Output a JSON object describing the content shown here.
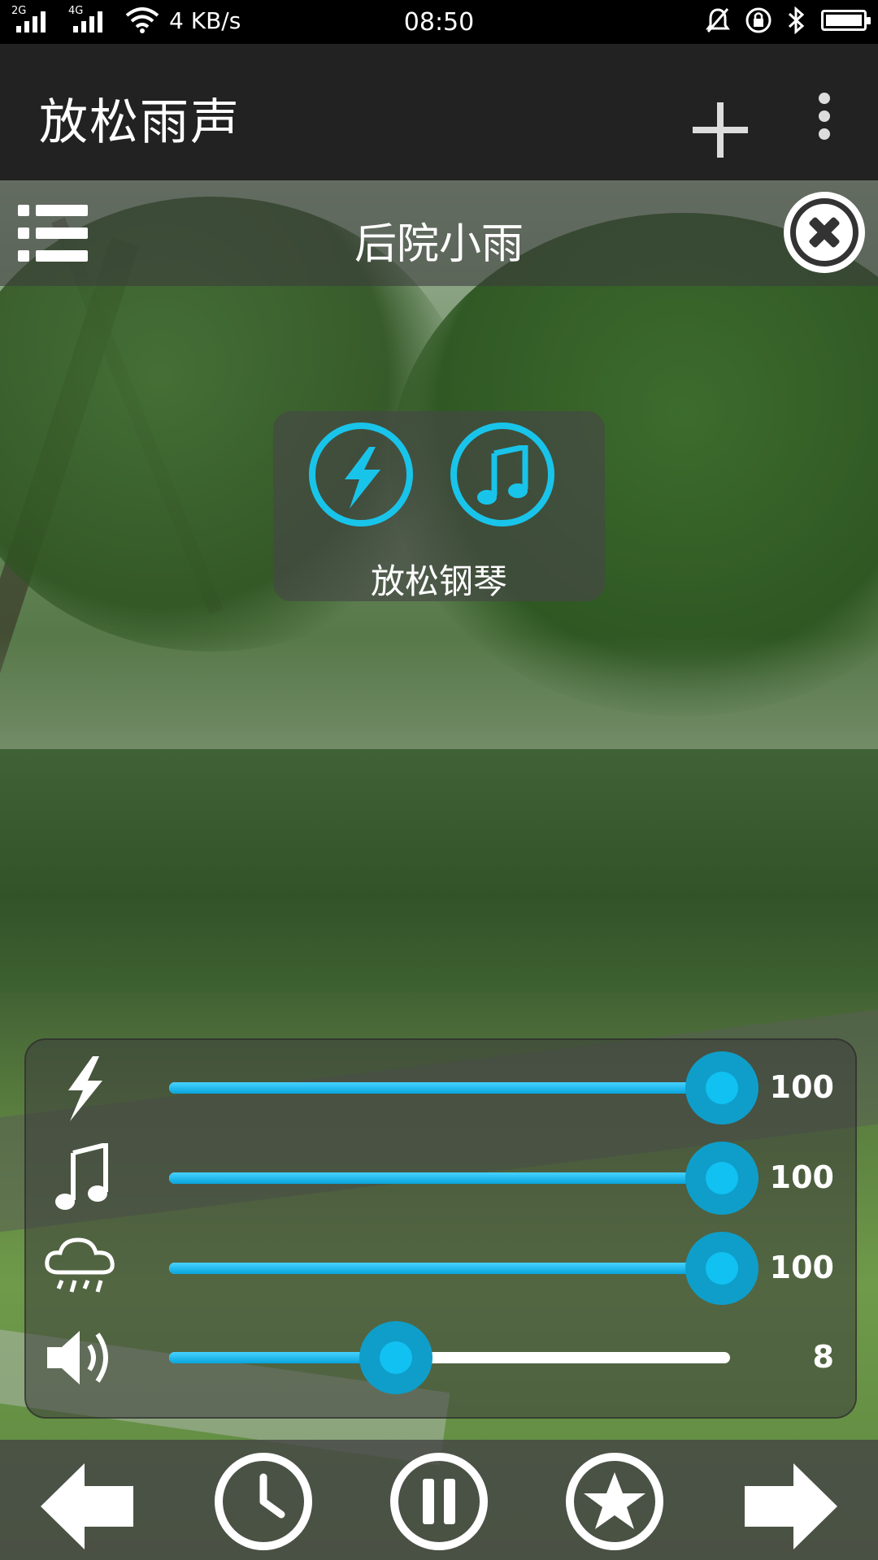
{
  "status_bar": {
    "network_1": "2G",
    "network_2": "4G",
    "speed": "4 KB/s",
    "time": "08:50",
    "icons": [
      "signal-icon",
      "wifi-icon",
      "mute-icon",
      "lock-rotation-icon",
      "bluetooth-icon",
      "battery-icon"
    ]
  },
  "app_bar": {
    "title": "放松雨声",
    "actions": [
      "add-icon",
      "more-vert-icon"
    ]
  },
  "scene": {
    "title": "后院小雨"
  },
  "mix": {
    "label": "放松钢琴",
    "buttons": [
      "lightning-icon",
      "music-note-icon"
    ]
  },
  "colors": {
    "accent": "#19c4ea",
    "slider_fill": "#0aa8de",
    "panel": "#3c3c3c"
  },
  "sliders": [
    {
      "icon": "lightning-icon",
      "value": "100",
      "level": 1.0
    },
    {
      "icon": "music-note-icon",
      "value": "100",
      "level": 1.0
    },
    {
      "icon": "rain-cloud-icon",
      "value": "100",
      "level": 1.0
    },
    {
      "icon": "volume-icon",
      "value": "8",
      "level": 0.5
    }
  ],
  "toolbar": [
    "previous-arrow-icon",
    "timer-icon",
    "pause-icon",
    "favorite-star-icon",
    "next-arrow-icon"
  ]
}
